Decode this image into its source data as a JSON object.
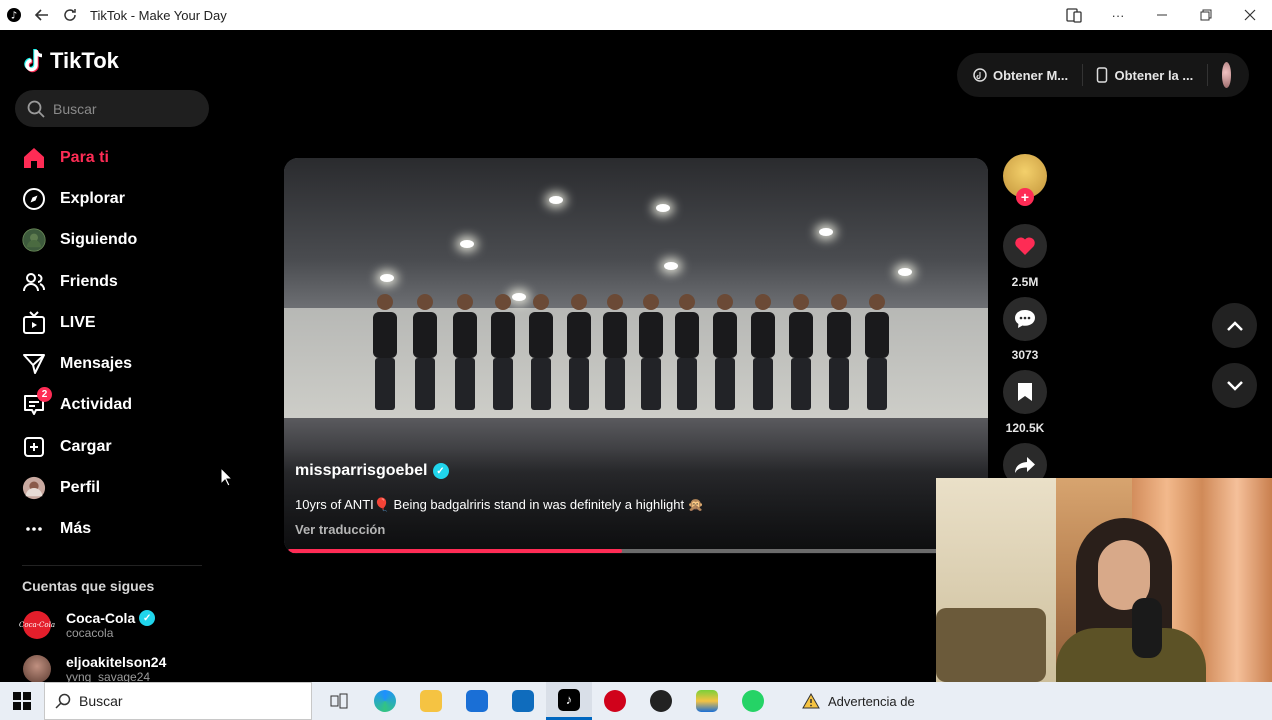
{
  "browser": {
    "title": "TikTok - Make Your Day"
  },
  "brand": {
    "name": "TikTok",
    "accent": "#fe2c55"
  },
  "search": {
    "placeholder": "Buscar"
  },
  "nav": [
    {
      "label": "Para ti",
      "icon": "home-icon",
      "active": true
    },
    {
      "label": "Explorar",
      "icon": "compass-icon"
    },
    {
      "label": "Siguiendo",
      "icon": "following-avatar-icon"
    },
    {
      "label": "Friends",
      "icon": "friends-icon"
    },
    {
      "label": "LIVE",
      "icon": "live-tv-icon"
    },
    {
      "label": "Mensajes",
      "icon": "send-icon"
    },
    {
      "label": "Actividad",
      "icon": "activity-icon",
      "badge": "2"
    },
    {
      "label": "Cargar",
      "icon": "upload-plus-icon"
    },
    {
      "label": "Perfil",
      "icon": "profile-avatar-icon"
    },
    {
      "label": "Más",
      "icon": "more-dots-icon"
    }
  ],
  "following": {
    "title": "Cuentas que sigues",
    "accounts": [
      {
        "name": "Coca-Cola",
        "handle": "cocacola",
        "verified": true
      },
      {
        "name": "eljoakitelson24",
        "handle": "yvng_savage24",
        "verified": false
      }
    ]
  },
  "topbar": {
    "get_coins": "Obtener M...",
    "get_app": "Obtener la ..."
  },
  "video": {
    "author": "missparrisgoebel",
    "verified": true,
    "description": "10yrs of ANTI🎈 Being badgalriris stand in was definitely a highlight 🙊",
    "translate": "Ver traducción",
    "progress": 0.48
  },
  "actions": {
    "likes": "2.5M",
    "comments": "3073",
    "saves": "120.5K"
  },
  "taskbar": {
    "search_label": "Buscar",
    "warning": "Advertencia de"
  }
}
